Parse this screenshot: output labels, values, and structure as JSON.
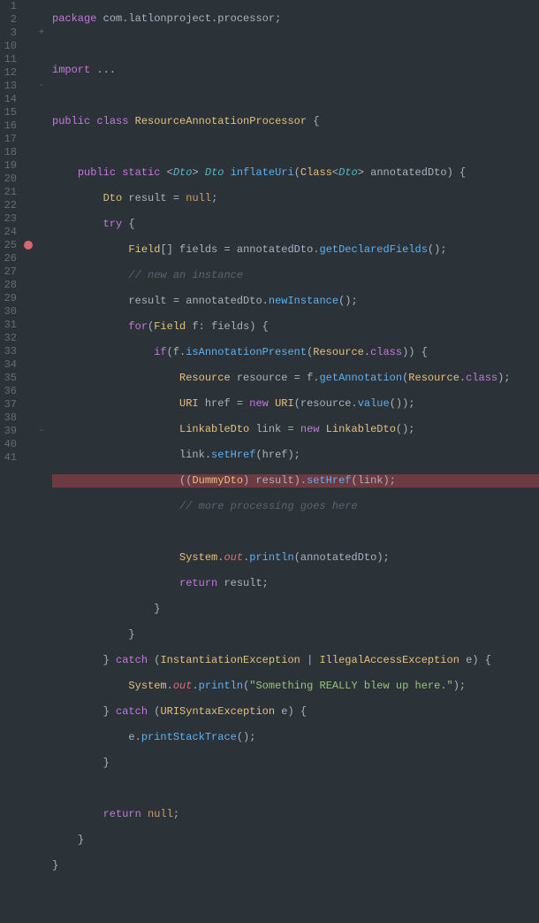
{
  "lines": [
    1,
    2,
    3,
    10,
    11,
    12,
    13,
    14,
    15,
    16,
    17,
    18,
    19,
    20,
    21,
    22,
    23,
    24,
    25,
    26,
    27,
    28,
    29,
    30,
    31,
    32,
    33,
    34,
    35,
    36,
    37,
    38,
    39,
    40,
    41
  ],
  "breakpoint_line": 25,
  "fold_marks": {
    "3": "+",
    "13": "-",
    "39": "-"
  },
  "code": {
    "l1": {
      "package": "package",
      "pkg": "com.latlonproject.processor"
    },
    "l3": {
      "import": "import",
      "rest": "..."
    },
    "l11": {
      "public": "public",
      "class": "class",
      "name": "ResourceAnnotationProcessor"
    },
    "l13": {
      "public": "public",
      "static": "static",
      "dto1": "Dto",
      "dto2": "Dto",
      "fn": "inflateUri",
      "cls": "Class",
      "dto3": "Dto",
      "param": "annotatedDto"
    },
    "l14": {
      "ty": "Dto",
      "var": "result",
      "null": "null"
    },
    "l15": {
      "try": "try"
    },
    "l16": {
      "ty": "Field",
      "var": "fields",
      "obj": "annotatedDto",
      "fn": "getDeclaredFields"
    },
    "l17": {
      "cm": "// new an instance"
    },
    "l18": {
      "var": "result",
      "obj": "annotatedDto",
      "fn": "newInstance"
    },
    "l19": {
      "for": "for",
      "ty": "Field",
      "v": "f",
      "arr": "fields"
    },
    "l20": {
      "if": "if",
      "obj": "f",
      "fn": "isAnnotationPresent",
      "ty": "Resource",
      "cls": "class"
    },
    "l21": {
      "ty": "Resource",
      "var": "resource",
      "obj": "f",
      "fn": "getAnnotation",
      "arg": "Resource",
      "cls": "class"
    },
    "l22": {
      "ty": "URI",
      "var": "href",
      "new": "new",
      "ctor": "URI",
      "obj": "resource",
      "fn": "value"
    },
    "l23": {
      "ty": "LinkableDto",
      "var": "link",
      "new": "new",
      "ctor": "LinkableDto"
    },
    "l24": {
      "obj": "link",
      "fn": "setHref",
      "arg": "href"
    },
    "l25": {
      "cast": "DummyDto",
      "obj": "result",
      "fn": "setHref",
      "arg": "link"
    },
    "l26": {
      "cm": "// more processing goes here"
    },
    "l28": {
      "sys": "System",
      "out": "out",
      "fn": "println",
      "arg": "annotatedDto"
    },
    "l29": {
      "return": "return",
      "var": "result"
    },
    "l32": {
      "catch": "catch",
      "ex1": "InstantiationException",
      "ex2": "IllegalAccessException",
      "v": "e"
    },
    "l33": {
      "sys": "System",
      "out": "out",
      "fn": "println",
      "str": "\"Something REALLY blew up here.\""
    },
    "l34": {
      "catch": "catch",
      "ex": "URISyntaxException",
      "v": "e"
    },
    "l35": {
      "obj": "e",
      "fn": "printStackTrace"
    },
    "l38": {
      "return": "return",
      "null": "null"
    }
  }
}
